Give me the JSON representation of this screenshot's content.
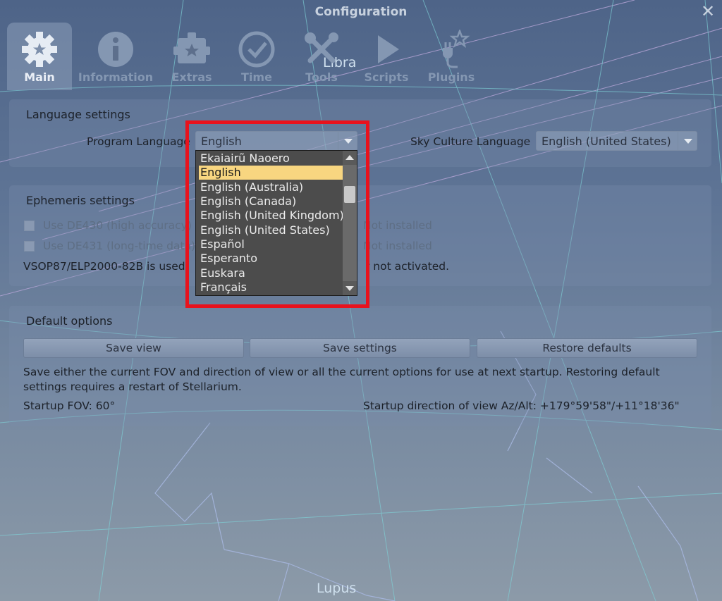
{
  "window": {
    "title": "Configuration",
    "close_icon": "close-icon"
  },
  "tabs": [
    {
      "label": "Main",
      "icon": "gear-icon",
      "active": true
    },
    {
      "label": "Information",
      "icon": "info-icon",
      "active": false
    },
    {
      "label": "Extras",
      "icon": "puzzle-gear-icon",
      "active": false
    },
    {
      "label": "Time",
      "icon": "clock-check-icon",
      "active": false
    },
    {
      "label": "Tools",
      "icon": "tools-icon",
      "active": false
    },
    {
      "label": "Scripts",
      "icon": "play-icon",
      "active": false
    },
    {
      "label": "Plugins",
      "icon": "plug-star-icon",
      "active": false
    }
  ],
  "sky_labels": {
    "libra": "Libra",
    "lupus": "Lupus"
  },
  "language": {
    "title": "Language settings",
    "program_label": "Program Language",
    "program_value": "English",
    "sky_label": "Sky Culture Language",
    "sky_value": "English (United States)"
  },
  "dropdown": {
    "items": [
      "Ekaiairũ Naoero",
      "English",
      "English (Australia)",
      "English (Canada)",
      "English (United Kingdom)",
      "English (United States)",
      "Español",
      "Esperanto",
      "Euskara",
      "Français"
    ],
    "selected": "English"
  },
  "ephemeris": {
    "title": "Ephemeris settings",
    "de430_label": "Use DE430 (high accuracy)",
    "de430_status": "Not installed",
    "de431_label": "Use DE431 (long-time data)",
    "de431_status": "Not installed",
    "note": "VSOP87/ELP2000-82B is used",
    "note_end": "r not activated."
  },
  "defaults": {
    "title": "Default options",
    "save_view": "Save view",
    "save_settings": "Save settings",
    "restore_defaults": "Restore defaults",
    "description": "Save either the current FOV and direction of view or all the current options for use at next startup. Restoring default settings requires a restart of Stellarium.",
    "startup_fov": "Startup FOV: 60°",
    "startup_direction": "Startup direction of view Az/Alt: +179°59'58\"/+11°18'36\""
  },
  "colors": {
    "highlight": "#e8121d",
    "selected_item": "#f8d680",
    "dropdown_bg": "#4c4c4c"
  }
}
